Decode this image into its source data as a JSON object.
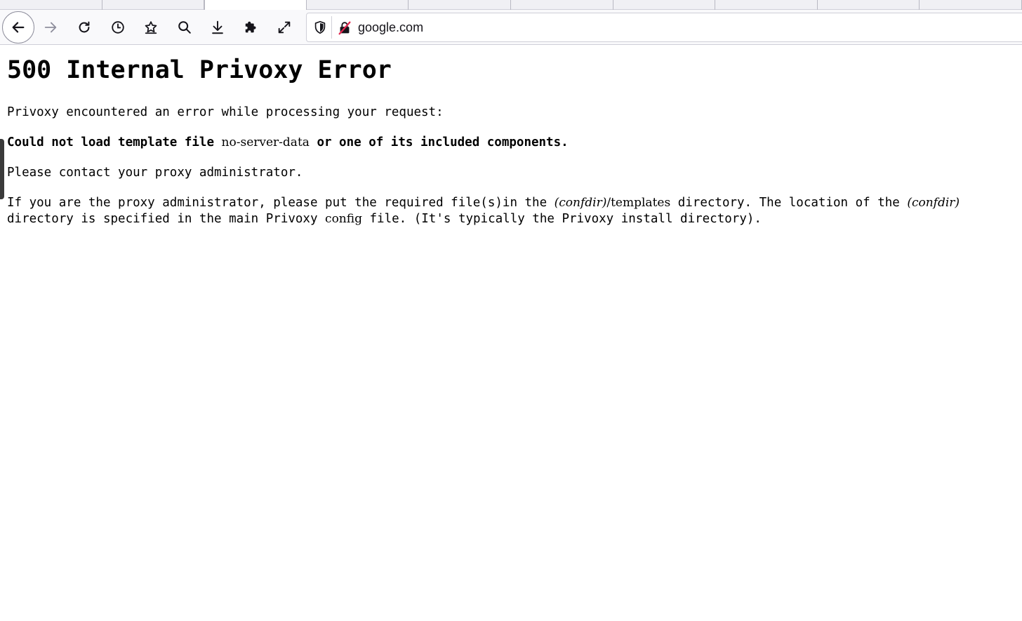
{
  "browser": {
    "tabs_count": 10,
    "url": "google.com",
    "toolbar_icons": [
      "back-icon",
      "forward-icon",
      "reload-icon",
      "history-icon",
      "bookmark-icon",
      "search-icon",
      "download-icon",
      "extensions-icon",
      "fullscreen-icon"
    ]
  },
  "page": {
    "title": "500 Internal Privoxy Error",
    "p1": "Privoxy encountered an error while processing your request:",
    "p2_a": "Could not load template file ",
    "p2_file": "no-server-data",
    "p2_b": " or one of its included components.",
    "p3": "Please contact your proxy administrator.",
    "p4_a": "If you are the proxy administrator, please put the required file(s)in the ",
    "p4_confdir1": "(confdir)",
    "p4_templates": "/templates",
    "p4_b": " directory. The location of the ",
    "p4_confdir2": "(confdir)",
    "p4_c": "directory is specified in the main Privoxy ",
    "p4_config": "config",
    "p4_d": " file. (It's typically the Privoxy install directory)."
  },
  "colors": {
    "toolbar_bg": "#f9f9fb",
    "text": "#000000",
    "icon": "#15141a",
    "insecure_red": "#e22850"
  }
}
